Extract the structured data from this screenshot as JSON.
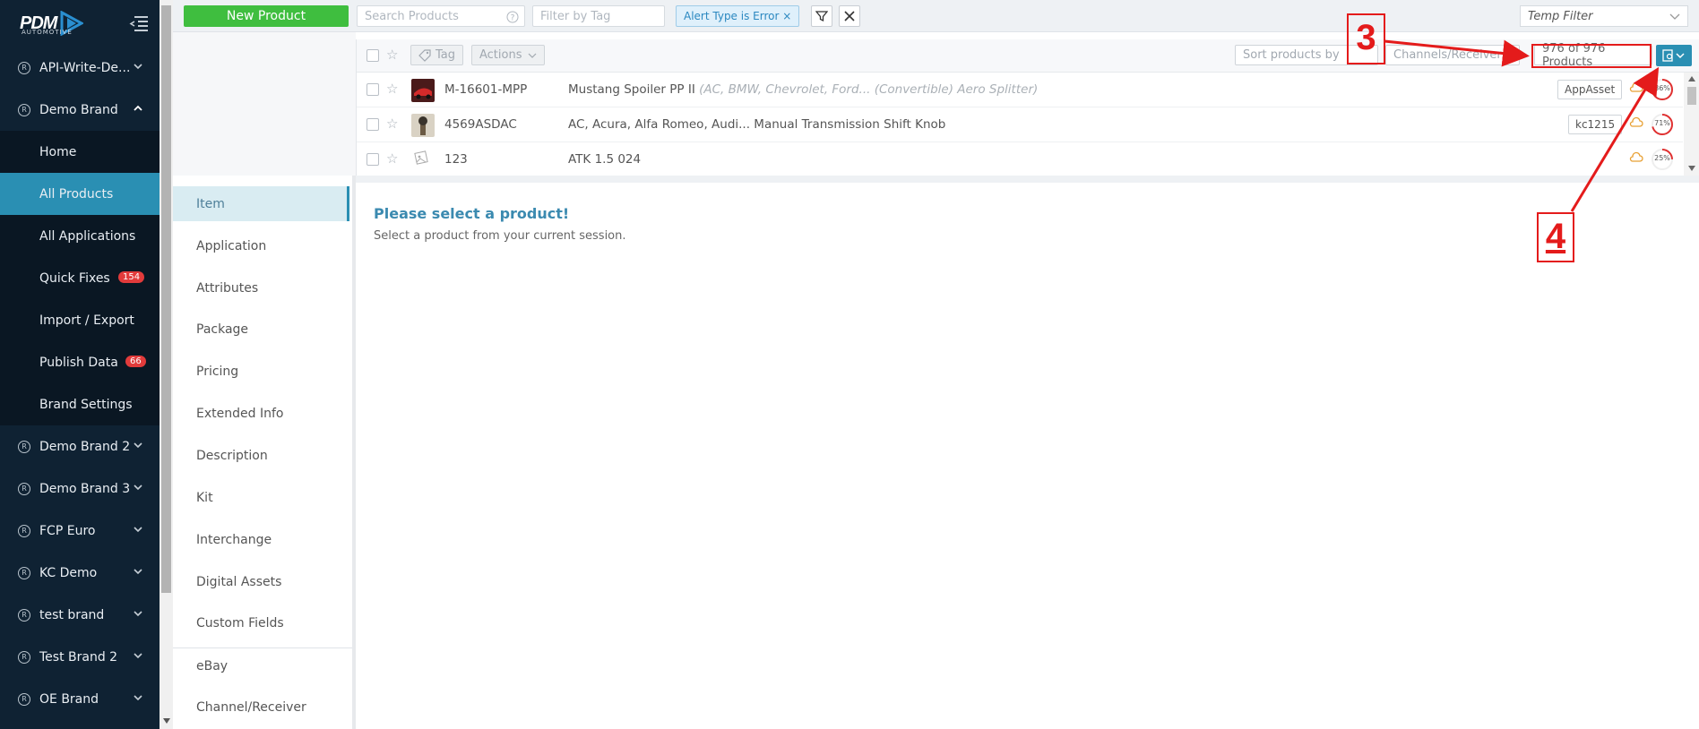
{
  "sidebar": {
    "logo_text": "PDM",
    "logo_sub": "AUTOMOTIVE",
    "brands_top": [
      {
        "label": "API-Write-De..."
      },
      {
        "label": "Demo Brand"
      }
    ],
    "items": [
      {
        "label": "Home"
      },
      {
        "label": "All Products"
      },
      {
        "label": "All Applications"
      },
      {
        "label": "Quick Fixes",
        "badge": "154"
      },
      {
        "label": "Import / Export"
      },
      {
        "label": "Publish Data",
        "badge": "66"
      },
      {
        "label": "Brand Settings"
      }
    ],
    "brands_bottom": [
      {
        "label": "Demo Brand 2"
      },
      {
        "label": "Demo Brand 3"
      },
      {
        "label": "FCP Euro"
      },
      {
        "label": "KC Demo"
      },
      {
        "label": "test brand"
      },
      {
        "label": "Test Brand 2"
      },
      {
        "label": "OE Brand"
      }
    ]
  },
  "toolbar": {
    "new_product": "New Product",
    "search_placeholder": "Search Products",
    "tag_placeholder": "Filter by Tag",
    "chip": "Alert Type is Error ×",
    "temp_filter": "Temp Filter"
  },
  "list": {
    "tag_btn": "Tag",
    "actions_btn": "Actions",
    "sort_label": "Sort products by",
    "channels_label": "Channels/Receivers",
    "count": "976 of 976 Products",
    "rows": [
      {
        "sku": "M-16601-MPP",
        "desc": "Mustang Spoiler PP II",
        "desc_extra": "(AC, BMW, Chevrolet, Ford... (Convertible) Aero Splitter)",
        "tag": "AppAsset",
        "pct": "86%"
      },
      {
        "sku": "4569ASDAC",
        "desc": "AC, Acura, Alfa Romeo, Audi... Manual Transmission Shift Knob",
        "desc_extra": "",
        "tag": "kc1215",
        "pct": "71%"
      },
      {
        "sku": "123",
        "desc": "ATK 1.5 024",
        "desc_extra": "",
        "tag": "",
        "pct": "25%"
      }
    ]
  },
  "nav": {
    "items": [
      "Item",
      "Application",
      "Attributes",
      "Package",
      "Pricing",
      "Extended Info",
      "Description",
      "Kit",
      "Interchange",
      "Digital Assets",
      "Custom Fields",
      "eBay",
      "Channel/Receiver"
    ]
  },
  "main": {
    "title": "Please select a product!",
    "subtitle": "Select a product from your current session."
  },
  "annotations": {
    "a3": "3",
    "a4": "4"
  },
  "colors": {
    "sidebar": "#0f2233",
    "active": "#2a8fb3",
    "green": "#3fbe3f",
    "annotation": "#e41b1b"
  }
}
